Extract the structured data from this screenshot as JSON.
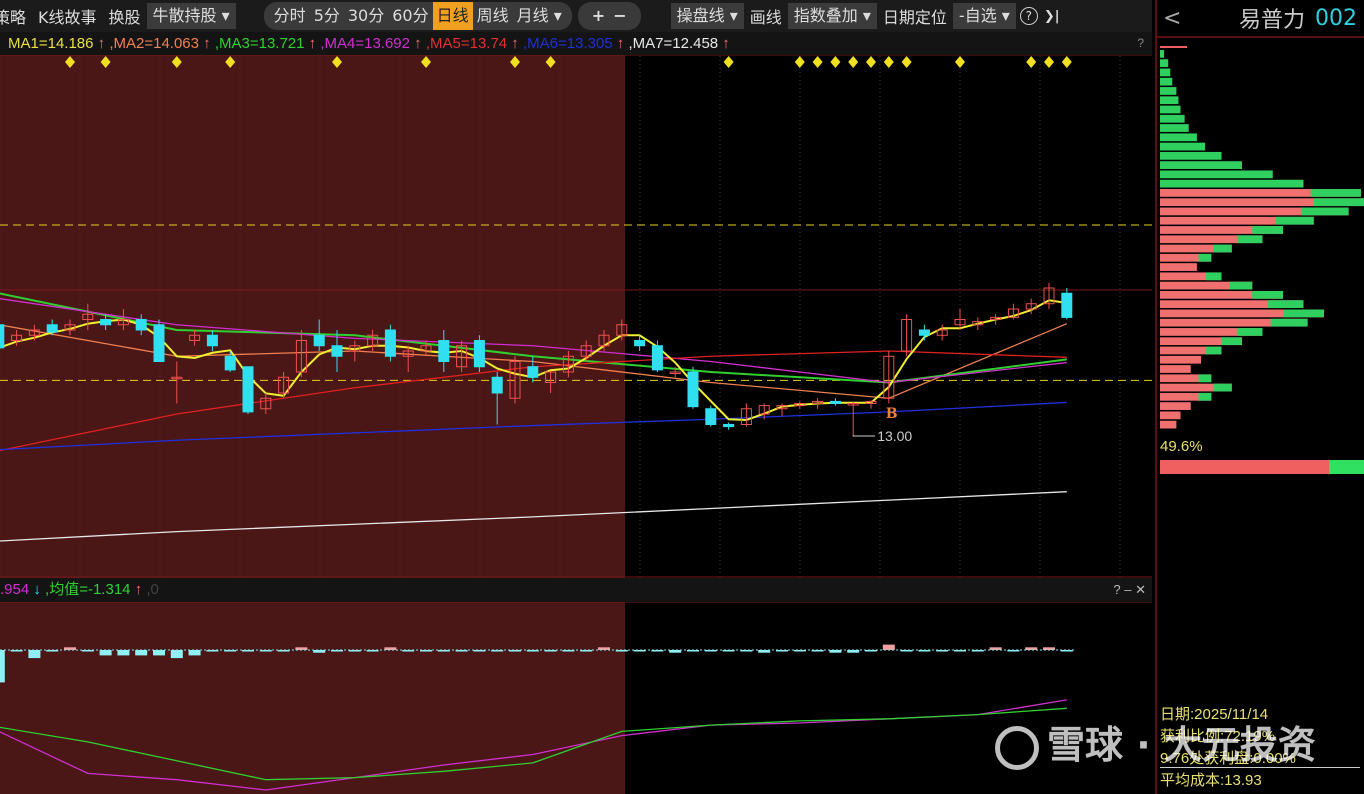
{
  "toolbar": {
    "items": [
      "策略",
      "K线故事",
      "换股"
    ],
    "holder": "牛散持股",
    "periods": [
      "分时",
      "5分",
      "30分",
      "60分",
      "日线",
      "周线",
      "月线"
    ],
    "active_period": "日线",
    "zoom_in": "+",
    "zoom_out": "−",
    "tools": [
      "操盘线",
      "画线",
      "指数叠加",
      "日期定位",
      "-自选"
    ],
    "help": "?",
    "collapse": "❯|"
  },
  "ma_labels": [
    {
      "text": "MA1=14.186",
      "color": "#e8e040"
    },
    {
      "text": ",MA2=14.063",
      "color": "#f08050"
    },
    {
      "text": ",MA3=13.721",
      "color": "#30d030"
    },
    {
      "text": ",MA4=13.692",
      "color": "#d030d0"
    },
    {
      "text": ",MA5=13.74",
      "color": "#e03030"
    },
    {
      "text": ",MA6=13.305",
      "color": "#2030d0"
    },
    {
      "text": ",MA7=12.458",
      "color": "#e8e8e8"
    }
  ],
  "up_arrow": "↑",
  "down_arrow": "↓",
  "question": "?",
  "price_marker": "13.00",
  "buy_signal": "B",
  "sub": {
    "value1": ".954",
    "value2": ",均值=-1.314",
    "value3": ",0",
    "controls": "? – ✕"
  },
  "right": {
    "back": "<",
    "stock_name": "易普力",
    "stock_code": "002",
    "pct": "49.6%",
    "profit_ratio_fraction": 0.83,
    "date": "日期:2025/11/14",
    "profit": "获利比例:72.19%",
    "profit_at": "9.76处获利盘:0.00%",
    "avg_cost": "平均成本:13.93"
  },
  "watermark": "雪球 · 大元投资",
  "colors": {
    "up": "#f05050",
    "down": "#30e0f0",
    "bg_history": "#4a1616",
    "ma1": "#f0f030"
  },
  "chart_data": {
    "type": "candlestick",
    "candles": [
      [
        14.05,
        14.1,
        13.8,
        13.83
      ],
      [
        13.9,
        14.0,
        13.85,
        13.95
      ],
      [
        13.95,
        14.05,
        13.9,
        14.0
      ],
      [
        14.05,
        14.1,
        13.95,
        13.98
      ],
      [
        14.0,
        14.1,
        13.95,
        14.05
      ],
      [
        14.1,
        14.25,
        14.0,
        14.15
      ],
      [
        14.1,
        14.15,
        14.0,
        14.05
      ],
      [
        14.05,
        14.2,
        14.0,
        14.1
      ],
      [
        14.1,
        14.15,
        13.95,
        14.0
      ],
      [
        14.05,
        14.1,
        13.7,
        13.7
      ],
      [
        13.55,
        13.7,
        13.3,
        13.55
      ],
      [
        13.9,
        14.0,
        13.85,
        13.95
      ],
      [
        13.95,
        14.0,
        13.8,
        13.85
      ],
      [
        13.75,
        13.8,
        13.6,
        13.62
      ],
      [
        13.65,
        13.65,
        13.2,
        13.22
      ],
      [
        13.25,
        13.4,
        13.2,
        13.35
      ],
      [
        13.4,
        13.6,
        13.35,
        13.55
      ],
      [
        13.6,
        14.0,
        13.55,
        13.9
      ],
      [
        13.95,
        14.1,
        13.8,
        13.85
      ],
      [
        13.85,
        14.0,
        13.6,
        13.75
      ],
      [
        13.8,
        13.9,
        13.7,
        13.85
      ],
      [
        13.85,
        14.0,
        13.8,
        13.95
      ],
      [
        14.0,
        14.05,
        13.7,
        13.75
      ],
      [
        13.75,
        13.85,
        13.6,
        13.8
      ],
      [
        13.8,
        13.9,
        13.75,
        13.85
      ],
      [
        13.9,
        14.0,
        13.6,
        13.7
      ],
      [
        13.65,
        13.9,
        13.6,
        13.85
      ],
      [
        13.9,
        13.95,
        13.6,
        13.65
      ],
      [
        13.55,
        13.6,
        13.1,
        13.4
      ],
      [
        13.35,
        13.75,
        13.3,
        13.7
      ],
      [
        13.65,
        13.75,
        13.5,
        13.55
      ],
      [
        13.5,
        13.6,
        13.4,
        13.6
      ],
      [
        13.6,
        13.8,
        13.55,
        13.75
      ],
      [
        13.75,
        13.9,
        13.7,
        13.85
      ],
      [
        13.85,
        14.0,
        13.8,
        13.95
      ],
      [
        13.95,
        14.1,
        13.9,
        14.05
      ],
      [
        13.9,
        13.95,
        13.8,
        13.85
      ],
      [
        13.85,
        13.9,
        13.6,
        13.62
      ],
      [
        13.6,
        13.65,
        13.55,
        13.6
      ],
      [
        13.6,
        13.65,
        13.25,
        13.27
      ],
      [
        13.25,
        13.28,
        13.08,
        13.1
      ],
      [
        13.1,
        13.12,
        13.05,
        13.08
      ],
      [
        13.1,
        13.3,
        13.08,
        13.25
      ],
      [
        13.2,
        13.3,
        13.15,
        13.28
      ],
      [
        13.25,
        13.3,
        13.18,
        13.28
      ],
      [
        13.28,
        13.32,
        13.25,
        13.3
      ],
      [
        13.3,
        13.35,
        13.25,
        13.32
      ],
      [
        13.32,
        13.35,
        13.28,
        13.3
      ],
      [
        13.3,
        13.32,
        13.0,
        13.3
      ],
      [
        13.3,
        13.33,
        13.25,
        13.32
      ],
      [
        13.35,
        13.8,
        13.3,
        13.75
      ],
      [
        13.8,
        14.15,
        13.75,
        14.1
      ],
      [
        14.0,
        14.05,
        13.9,
        13.95
      ],
      [
        13.95,
        14.05,
        13.9,
        14.0
      ],
      [
        14.05,
        14.2,
        14.0,
        14.1
      ],
      [
        14.05,
        14.12,
        14.0,
        14.08
      ],
      [
        14.1,
        14.15,
        14.05,
        14.12
      ],
      [
        14.12,
        14.25,
        14.1,
        14.2
      ],
      [
        14.2,
        14.3,
        14.15,
        14.25
      ],
      [
        14.25,
        14.45,
        14.2,
        14.4
      ],
      [
        14.35,
        14.4,
        14.1,
        14.12
      ]
    ],
    "ma_lines": {
      "at": [
        1,
        11,
        21,
        31,
        41,
        51,
        61
      ],
      "series": [
        {
          "name": "MA2",
          "color": "#f08050",
          "values": [
            14.05,
            13.75,
            13.8,
            13.7,
            13.5,
            13.35,
            14.06
          ]
        },
        {
          "name": "MA3",
          "color": "#30d030",
          "values": [
            14.35,
            14.0,
            13.95,
            13.75,
            13.6,
            13.5,
            13.72
          ]
        },
        {
          "name": "MA4",
          "color": "#d030d0",
          "values": [
            14.3,
            14.05,
            13.92,
            13.85,
            13.7,
            13.5,
            13.69
          ]
        },
        {
          "name": "MA5",
          "color": "#e02020",
          "values": [
            12.85,
            13.2,
            13.45,
            13.65,
            13.75,
            13.8,
            13.74
          ]
        },
        {
          "name": "MA6",
          "color": "#2030e0",
          "values": [
            12.86,
            12.95,
            13.02,
            13.09,
            13.15,
            13.22,
            13.31
          ]
        },
        {
          "name": "MA7",
          "color": "#e8e8e8",
          "values": [
            11.99,
            12.08,
            12.15,
            12.22,
            12.3,
            12.38,
            12.46
          ]
        }
      ]
    },
    "hlines": [
      15.0,
      13.52
    ],
    "signals": [
      5,
      7,
      11,
      14,
      20,
      25,
      30,
      32,
      42,
      46,
      47,
      48,
      49,
      50,
      51,
      52,
      55,
      59,
      60,
      61
    ],
    "sub_bars": [
      -1.2,
      0,
      -0.3,
      0,
      0.1,
      0,
      -0.2,
      -0.2,
      -0.2,
      -0.2,
      -0.3,
      -0.2,
      0,
      0,
      0,
      0,
      0,
      0.1,
      -0.1,
      0,
      0,
      0,
      0.1,
      0,
      0,
      0,
      0,
      0,
      0,
      0,
      0,
      0,
      0,
      0,
      0.1,
      0,
      0,
      0,
      -0.1,
      0,
      0,
      0,
      0,
      -0.1,
      0,
      0,
      0,
      -0.1,
      -0.1,
      0,
      0.2,
      0,
      0,
      0,
      0,
      0,
      0.1,
      0,
      0.1,
      0.1,
      0
    ],
    "sub_lines": {
      "at": [
        1,
        6,
        11,
        16,
        21,
        26,
        31,
        36,
        41,
        46,
        51,
        56,
        61
      ],
      "series": [
        {
          "name": "MA",
          "color": "#d030d0",
          "values": [
            -2.4,
            -4.4,
            -4.7,
            -5.2,
            -4.6,
            -4.0,
            -3.5,
            -2.6,
            -2.1,
            -2.0,
            -1.8,
            -1.6,
            -0.9
          ]
        },
        {
          "name": "均值",
          "color": "#30d030",
          "values": [
            -2.2,
            -2.9,
            -3.8,
            -4.7,
            -4.6,
            -4.3,
            -3.9,
            -2.4,
            -2.1,
            -1.9,
            -1.8,
            -1.6,
            -1.3
          ]
        }
      ]
    },
    "profile": [
      2,
      4,
      5,
      6,
      8,
      9,
      10,
      12,
      14,
      18,
      22,
      30,
      40,
      55,
      70,
      98,
      100,
      92,
      75,
      60,
      50,
      35,
      25,
      18,
      30,
      45,
      60,
      70,
      80,
      72,
      50,
      40,
      30,
      20,
      15,
      25,
      35,
      25,
      15,
      10,
      8
    ]
  }
}
